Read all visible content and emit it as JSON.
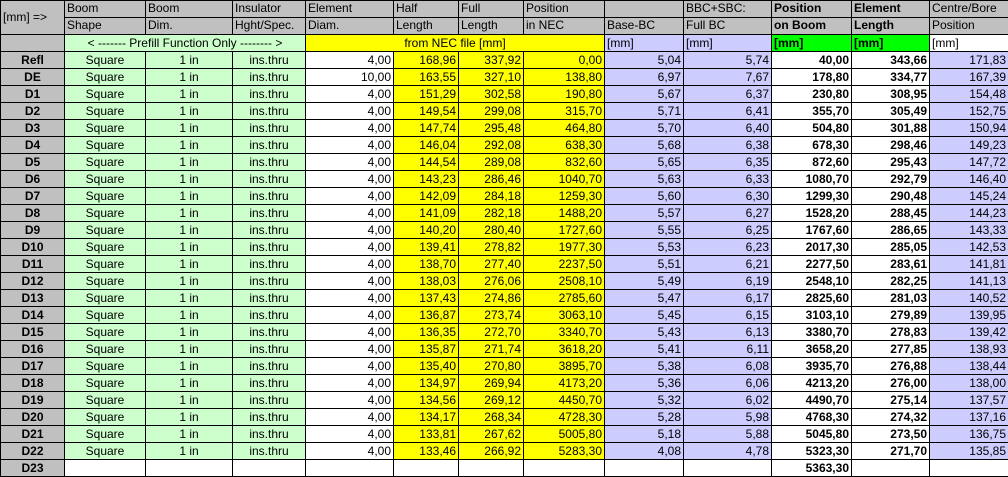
{
  "header": {
    "row_label": "[mm] =>",
    "cols": [
      {
        "l1": "Boom",
        "l2": "Shape"
      },
      {
        "l1": "Boom",
        "l2": "Dim."
      },
      {
        "l1": "Insulator",
        "l2": "Hght/Spec."
      },
      {
        "l1": "Element",
        "l2": "Diam."
      },
      {
        "l1": "Half",
        "l2": "Length"
      },
      {
        "l1": "Full",
        "l2": "Length"
      },
      {
        "l1": "Position",
        "l2": "in NEC"
      },
      {
        "l1": "",
        "l2": "Base-BC"
      },
      {
        "l1": "BBC+SBC:",
        "l2": "Full BC"
      },
      {
        "l1": "Position",
        "l2": "on Boom"
      },
      {
        "l1": "Element",
        "l2": "Length"
      },
      {
        "l1": "Centre/Bore",
        "l2": "Position"
      }
    ],
    "prefill_note": "< ------- Prefill Function Only -------- >",
    "nec_note": "from NEC file [mm]",
    "units": "[mm]"
  },
  "colors": {
    "green": "#ccffcc",
    "yellow": "#ffff00",
    "purple": "#ccccff",
    "bright_green": "#00ff00"
  },
  "rows": [
    {
      "label": "Refl",
      "shape": "Square",
      "dim": "1 in",
      "ins": "ins.thru",
      "diam": "4,00",
      "half": "168,96",
      "full": "337,92",
      "pos_nec": "0,00",
      "base_bc": "5,04",
      "full_bc": "5,74",
      "pos_boom": "40,00",
      "elem_len": "343,66",
      "centre": "171,83"
    },
    {
      "label": "DE",
      "shape": "Square",
      "dim": "1 in",
      "ins": "ins.thru",
      "diam": "10,00",
      "half": "163,55",
      "full": "327,10",
      "pos_nec": "138,80",
      "base_bc": "6,97",
      "full_bc": "7,67",
      "pos_boom": "178,80",
      "elem_len": "334,77",
      "centre": "167,39"
    },
    {
      "label": "D1",
      "shape": "Square",
      "dim": "1 in",
      "ins": "ins.thru",
      "diam": "4,00",
      "half": "151,29",
      "full": "302,58",
      "pos_nec": "190,80",
      "base_bc": "5,67",
      "full_bc": "6,37",
      "pos_boom": "230,80",
      "elem_len": "308,95",
      "centre": "154,48"
    },
    {
      "label": "D2",
      "shape": "Square",
      "dim": "1 in",
      "ins": "ins.thru",
      "diam": "4,00",
      "half": "149,54",
      "full": "299,08",
      "pos_nec": "315,70",
      "base_bc": "5,71",
      "full_bc": "6,41",
      "pos_boom": "355,70",
      "elem_len": "305,49",
      "centre": "152,75"
    },
    {
      "label": "D3",
      "shape": "Square",
      "dim": "1 in",
      "ins": "ins.thru",
      "diam": "4,00",
      "half": "147,74",
      "full": "295,48",
      "pos_nec": "464,80",
      "base_bc": "5,70",
      "full_bc": "6,40",
      "pos_boom": "504,80",
      "elem_len": "301,88",
      "centre": "150,94"
    },
    {
      "label": "D4",
      "shape": "Square",
      "dim": "1 in",
      "ins": "ins.thru",
      "diam": "4,00",
      "half": "146,04",
      "full": "292,08",
      "pos_nec": "638,30",
      "base_bc": "5,68",
      "full_bc": "6,38",
      "pos_boom": "678,30",
      "elem_len": "298,46",
      "centre": "149,23"
    },
    {
      "label": "D5",
      "shape": "Square",
      "dim": "1 in",
      "ins": "ins.thru",
      "diam": "4,00",
      "half": "144,54",
      "full": "289,08",
      "pos_nec": "832,60",
      "base_bc": "5,65",
      "full_bc": "6,35",
      "pos_boom": "872,60",
      "elem_len": "295,43",
      "centre": "147,72"
    },
    {
      "label": "D6",
      "shape": "Square",
      "dim": "1 in",
      "ins": "ins.thru",
      "diam": "4,00",
      "half": "143,23",
      "full": "286,46",
      "pos_nec": "1040,70",
      "base_bc": "5,63",
      "full_bc": "6,33",
      "pos_boom": "1080,70",
      "elem_len": "292,79",
      "centre": "146,40"
    },
    {
      "label": "D7",
      "shape": "Square",
      "dim": "1 in",
      "ins": "ins.thru",
      "diam": "4,00",
      "half": "142,09",
      "full": "284,18",
      "pos_nec": "1259,30",
      "base_bc": "5,60",
      "full_bc": "6,30",
      "pos_boom": "1299,30",
      "elem_len": "290,48",
      "centre": "145,24"
    },
    {
      "label": "D8",
      "shape": "Square",
      "dim": "1 in",
      "ins": "ins.thru",
      "diam": "4,00",
      "half": "141,09",
      "full": "282,18",
      "pos_nec": "1488,20",
      "base_bc": "5,57",
      "full_bc": "6,27",
      "pos_boom": "1528,20",
      "elem_len": "288,45",
      "centre": "144,23"
    },
    {
      "label": "D9",
      "shape": "Square",
      "dim": "1 in",
      "ins": "ins.thru",
      "diam": "4,00",
      "half": "140,20",
      "full": "280,40",
      "pos_nec": "1727,60",
      "base_bc": "5,55",
      "full_bc": "6,25",
      "pos_boom": "1767,60",
      "elem_len": "286,65",
      "centre": "143,33"
    },
    {
      "label": "D10",
      "shape": "Square",
      "dim": "1 in",
      "ins": "ins.thru",
      "diam": "4,00",
      "half": "139,41",
      "full": "278,82",
      "pos_nec": "1977,30",
      "base_bc": "5,53",
      "full_bc": "6,23",
      "pos_boom": "2017,30",
      "elem_len": "285,05",
      "centre": "142,53"
    },
    {
      "label": "D11",
      "shape": "Square",
      "dim": "1 in",
      "ins": "ins.thru",
      "diam": "4,00",
      "half": "138,70",
      "full": "277,40",
      "pos_nec": "2237,50",
      "base_bc": "5,51",
      "full_bc": "6,21",
      "pos_boom": "2277,50",
      "elem_len": "283,61",
      "centre": "141,81"
    },
    {
      "label": "D12",
      "shape": "Square",
      "dim": "1 in",
      "ins": "ins.thru",
      "diam": "4,00",
      "half": "138,03",
      "full": "276,06",
      "pos_nec": "2508,10",
      "base_bc": "5,49",
      "full_bc": "6,19",
      "pos_boom": "2548,10",
      "elem_len": "282,25",
      "centre": "141,13"
    },
    {
      "label": "D13",
      "shape": "Square",
      "dim": "1 in",
      "ins": "ins.thru",
      "diam": "4,00",
      "half": "137,43",
      "full": "274,86",
      "pos_nec": "2785,60",
      "base_bc": "5,47",
      "full_bc": "6,17",
      "pos_boom": "2825,60",
      "elem_len": "281,03",
      "centre": "140,52"
    },
    {
      "label": "D14",
      "shape": "Square",
      "dim": "1 in",
      "ins": "ins.thru",
      "diam": "4,00",
      "half": "136,87",
      "full": "273,74",
      "pos_nec": "3063,10",
      "base_bc": "5,45",
      "full_bc": "6,15",
      "pos_boom": "3103,10",
      "elem_len": "279,89",
      "centre": "139,95"
    },
    {
      "label": "D15",
      "shape": "Square",
      "dim": "1 in",
      "ins": "ins.thru",
      "diam": "4,00",
      "half": "136,35",
      "full": "272,70",
      "pos_nec": "3340,70",
      "base_bc": "5,43",
      "full_bc": "6,13",
      "pos_boom": "3380,70",
      "elem_len": "278,83",
      "centre": "139,42"
    },
    {
      "label": "D16",
      "shape": "Square",
      "dim": "1 in",
      "ins": "ins.thru",
      "diam": "4,00",
      "half": "135,87",
      "full": "271,74",
      "pos_nec": "3618,20",
      "base_bc": "5,41",
      "full_bc": "6,11",
      "pos_boom": "3658,20",
      "elem_len": "277,85",
      "centre": "138,93"
    },
    {
      "label": "D17",
      "shape": "Square",
      "dim": "1 in",
      "ins": "ins.thru",
      "diam": "4,00",
      "half": "135,40",
      "full": "270,80",
      "pos_nec": "3895,70",
      "base_bc": "5,38",
      "full_bc": "6,08",
      "pos_boom": "3935,70",
      "elem_len": "276,88",
      "centre": "138,44"
    },
    {
      "label": "D18",
      "shape": "Square",
      "dim": "1 in",
      "ins": "ins.thru",
      "diam": "4,00",
      "half": "134,97",
      "full": "269,94",
      "pos_nec": "4173,20",
      "base_bc": "5,36",
      "full_bc": "6,06",
      "pos_boom": "4213,20",
      "elem_len": "276,00",
      "centre": "138,00"
    },
    {
      "label": "D19",
      "shape": "Square",
      "dim": "1 in",
      "ins": "ins.thru",
      "diam": "4,00",
      "half": "134,56",
      "full": "269,12",
      "pos_nec": "4450,70",
      "base_bc": "5,32",
      "full_bc": "6,02",
      "pos_boom": "4490,70",
      "elem_len": "275,14",
      "centre": "137,57"
    },
    {
      "label": "D20",
      "shape": "Square",
      "dim": "1 in",
      "ins": "ins.thru",
      "diam": "4,00",
      "half": "134,17",
      "full": "268,34",
      "pos_nec": "4728,30",
      "base_bc": "5,28",
      "full_bc": "5,98",
      "pos_boom": "4768,30",
      "elem_len": "274,32",
      "centre": "137,16"
    },
    {
      "label": "D21",
      "shape": "Square",
      "dim": "1 in",
      "ins": "ins.thru",
      "diam": "4,00",
      "half": "133,81",
      "full": "267,62",
      "pos_nec": "5005,80",
      "base_bc": "5,18",
      "full_bc": "5,88",
      "pos_boom": "5045,80",
      "elem_len": "273,50",
      "centre": "136,75"
    },
    {
      "label": "D22",
      "shape": "Square",
      "dim": "1 in",
      "ins": "ins.thru",
      "diam": "4,00",
      "half": "133,46",
      "full": "266,92",
      "pos_nec": "5283,30",
      "base_bc": "4,08",
      "full_bc": "4,78",
      "pos_boom": "5323,30",
      "elem_len": "271,70",
      "centre": "135,85"
    }
  ],
  "last_row": {
    "label": "D23",
    "pos_boom": "5363,30"
  }
}
